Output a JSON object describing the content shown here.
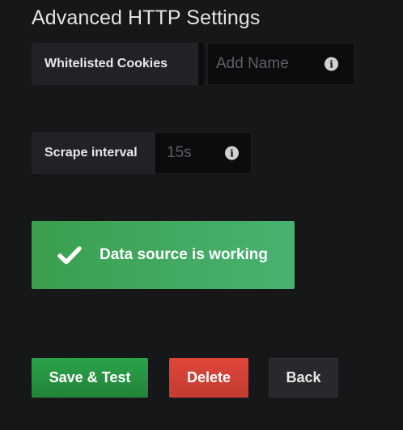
{
  "section": {
    "title": "Advanced HTTP Settings"
  },
  "cookies": {
    "label": "Whitelisted Cookies",
    "placeholder": "Add Name",
    "info_icon": "info-icon"
  },
  "scrape": {
    "label": "Scrape interval",
    "placeholder": "15s",
    "info_icon": "info-icon"
  },
  "alert": {
    "icon": "checkmark-icon",
    "message": "Data source is working",
    "color": "#3fa75c"
  },
  "buttons": {
    "save": "Save & Test",
    "delete": "Delete",
    "back": "Back"
  },
  "colors": {
    "background": "#161719",
    "success": "#299c46",
    "danger": "#d44a3a",
    "secondary": "#27292c"
  }
}
